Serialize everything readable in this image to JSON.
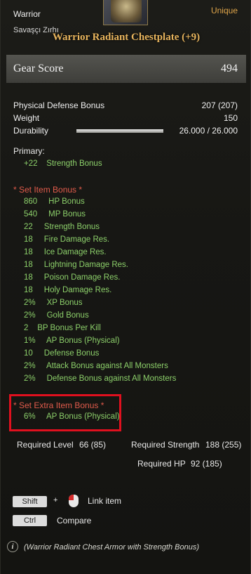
{
  "item": {
    "class": "Warrior",
    "subname": "Savaşçı Zırhı",
    "rarity": "Unique",
    "title": "Warrior Radiant Chestplate (+9)",
    "icon": "chest-armor-icon"
  },
  "gear_score": {
    "label": "Gear Score",
    "value": "494"
  },
  "stats": [
    {
      "label": "Physical Defense Bonus",
      "value": "207 (207)"
    },
    {
      "label": "Weight",
      "value": "150"
    },
    {
      "label": "Durability",
      "value": "26.000 / 26.000",
      "fill": 1.0
    }
  ],
  "primary": {
    "label": "Primary:",
    "value": "+22",
    "name": "Strength Bonus"
  },
  "set_bonus": {
    "label": "* Set Item  Bonus *",
    "items": [
      {
        "value": "860",
        "name": "HP Bonus"
      },
      {
        "value": "540",
        "name": "MP Bonus"
      },
      {
        "value": "22",
        "name": "Strength Bonus"
      },
      {
        "value": "18",
        "name": "Fire Damage Res."
      },
      {
        "value": "18",
        "name": "Ice Damage Res."
      },
      {
        "value": "18",
        "name": "Lightning Damage Res."
      },
      {
        "value": "18",
        "name": "Poison Damage Res."
      },
      {
        "value": "18",
        "name": "Holy Damage Res."
      },
      {
        "value": "2%",
        "name": "XP Bonus"
      },
      {
        "value": "2%",
        "name": "Gold Bonus"
      },
      {
        "value": "2",
        "name": "BP Bonus Per Kill"
      },
      {
        "value": "1%",
        "name": "AP Bonus (Physical)"
      },
      {
        "value": "10",
        "name": "Defense Bonus"
      },
      {
        "value": "2%",
        "name": "Attack Bonus against All Monsters"
      },
      {
        "value": "2%",
        "name": "Defense Bonus against All Monsters"
      }
    ]
  },
  "extra_bonus": {
    "label": "* Set Extra Item Bonus *",
    "value": "6%",
    "name": "AP Bonus (Physical)"
  },
  "requirements": {
    "level_label": "Required Level",
    "level_value": "66 (85)",
    "strength_label": "Required Strength",
    "strength_value": "188 (255)",
    "hp_label": "Required HP",
    "hp_value": "92 (185)"
  },
  "controls": {
    "shift_key": "Shift",
    "plus": "+",
    "link_label": "Link item",
    "ctrl_key": "Ctrl",
    "compare_label": "Compare"
  },
  "description": "(Warrior Radiant Chest Armor with Strength Bonus)",
  "colors": {
    "title": "#e7b45d",
    "rarity": "#e0a64a",
    "bonus_green": "#8ccf6a",
    "set_red": "#e15b4b",
    "highlight_box": "#e0101e"
  }
}
